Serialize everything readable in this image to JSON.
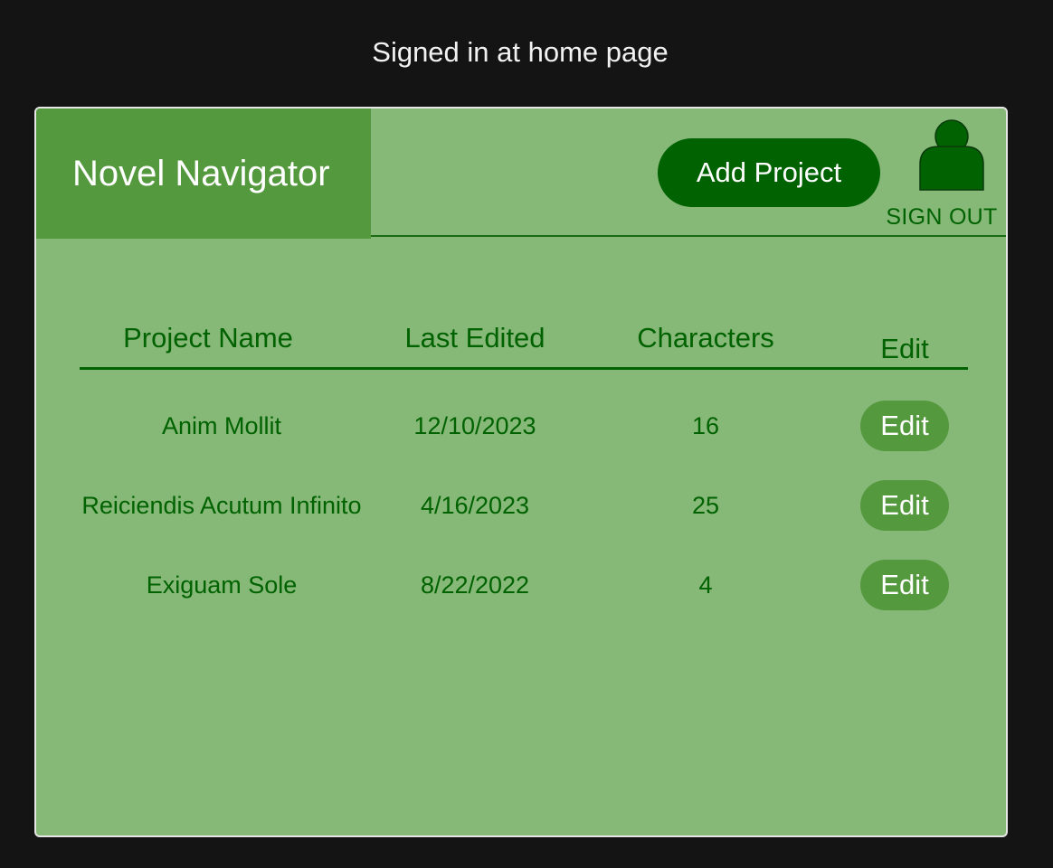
{
  "caption": "Signed in at home page",
  "app": {
    "title": "Novel Navigator"
  },
  "header": {
    "add_project_label": "Add Project",
    "profile_icon": "user-icon",
    "sign_out_label": "SIGN OUT"
  },
  "table": {
    "columns": [
      "Project Name",
      "Last Edited",
      "Characters",
      "Edit"
    ],
    "rows": [
      {
        "name": "Anim Mollit",
        "last_edited": "12/10/2023",
        "characters": "16",
        "edit_label": "Edit"
      },
      {
        "name": "Reiciendis Acutum Infinito",
        "last_edited": "4/16/2023",
        "characters": "25",
        "edit_label": "Edit"
      },
      {
        "name": "Exiguam Sole",
        "last_edited": "8/22/2022",
        "characters": "4",
        "edit_label": "Edit"
      }
    ]
  },
  "colors": {
    "page_background": "#141414",
    "panel_background": "#86b878",
    "brand_background": "#55993f",
    "primary_green": "#006200",
    "edit_button": "#55993f"
  }
}
